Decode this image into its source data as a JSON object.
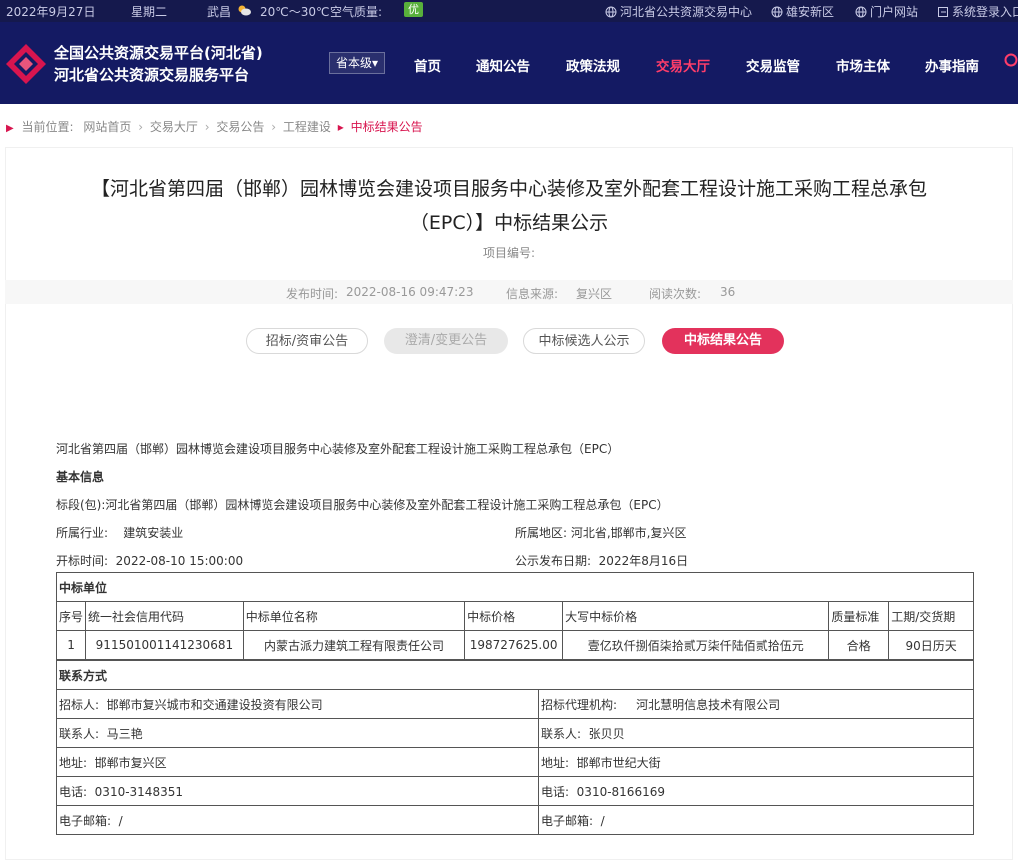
{
  "topbar": {
    "date": "2022年9月27日",
    "weekday": "星期二",
    "city": "武昌",
    "temp": "20℃～30℃",
    "air_label": "空气质量:",
    "air_value": "优",
    "links": [
      "河北省公共资源交易中心",
      "雄安新区",
      "门户网站",
      "系统登录入口"
    ]
  },
  "header": {
    "brand_line1": "全国公共资源交易平台(河北省)",
    "brand_line2": "河北省公共资源交易服务平台",
    "region_select": "省本级",
    "nav": [
      "首页",
      "通知公告",
      "政策法规",
      "交易大厅",
      "交易监管",
      "市场主体",
      "办事指南"
    ],
    "active_nav": "交易大厅"
  },
  "breadcrumb": {
    "label": "当前位置:",
    "items": [
      "网站首页",
      "交易大厅",
      "交易公告",
      "工程建设"
    ],
    "current": "中标结果公告"
  },
  "article": {
    "title_line1": "【河北省第四届（邯郸）园林博览会建设项目服务中心装修及室外配套工程设计施工采购工程总承包",
    "title_line2": "（EPC）】中标结果公示",
    "project_no_label": "项目编号:",
    "publish_time_label": "发布时间:",
    "publish_time": "2022-08-16 09:47:23",
    "source_label": "信息来源:",
    "source": "复兴区",
    "views_label": "阅读次数:",
    "views": "36"
  },
  "tabs": [
    "招标/资审公告",
    "澄清/变更公告",
    "中标候选人公示",
    "中标结果公告"
  ],
  "body": {
    "project_name": "河北省第四届（邯郸）园林博览会建设项目服务中心装修及室外配套工程设计施工采购工程总承包（EPC）",
    "basic_info_heading": "基本信息",
    "section": "标段(包):河北省第四届（邯郸）园林博览会建设项目服务中心装修及室外配套工程设计施工采购工程总承包（EPC）",
    "industry": "所属行业:    建筑安装业",
    "region": "所属地区: 河北省,邯郸市,复兴区",
    "open_time": "开标时间:  2022-08-10 15:00:00",
    "publish_date": "公示发布日期:  2022年8月16日"
  },
  "winner_table": {
    "heading": "中标单位",
    "columns": [
      "序号",
      "统一社会信用代码",
      "中标单位名称",
      "中标价格",
      "大写中标价格",
      "质量标准",
      "工期/交货期"
    ],
    "rows": [
      [
        "1",
        "911501001141230681",
        "内蒙古派力建筑工程有限责任公司",
        "198727625.00",
        "壹亿玖仟捌佰柒拾贰万柒仟陆佰贰拾伍元",
        "合格",
        "90日历天"
      ]
    ]
  },
  "contact_table": {
    "heading": "联系方式",
    "rows": [
      [
        "招标人:  邯郸市复兴城市和交通建设投资有限公司",
        "招标代理机构:     河北慧明信息技术有限公司"
      ],
      [
        "联系人:  马三艳",
        "联系人:  张贝贝"
      ],
      [
        "地址:  邯郸市复兴区",
        "地址:  邯郸市世纪大街"
      ],
      [
        "电话:  0310-3148351",
        "电话:  0310-8166169"
      ],
      [
        "电子邮箱:  /",
        "电子邮箱:  /"
      ]
    ]
  },
  "colors": {
    "header_bg": "#141a63",
    "topbar_bg": "#15194d",
    "accent": "#e3325c",
    "air_good": "#58b03b"
  },
  "icons": [
    "sun-cloud-icon",
    "globe-icon",
    "globe-icon",
    "globe-icon",
    "login-icon",
    "search-icon"
  ]
}
